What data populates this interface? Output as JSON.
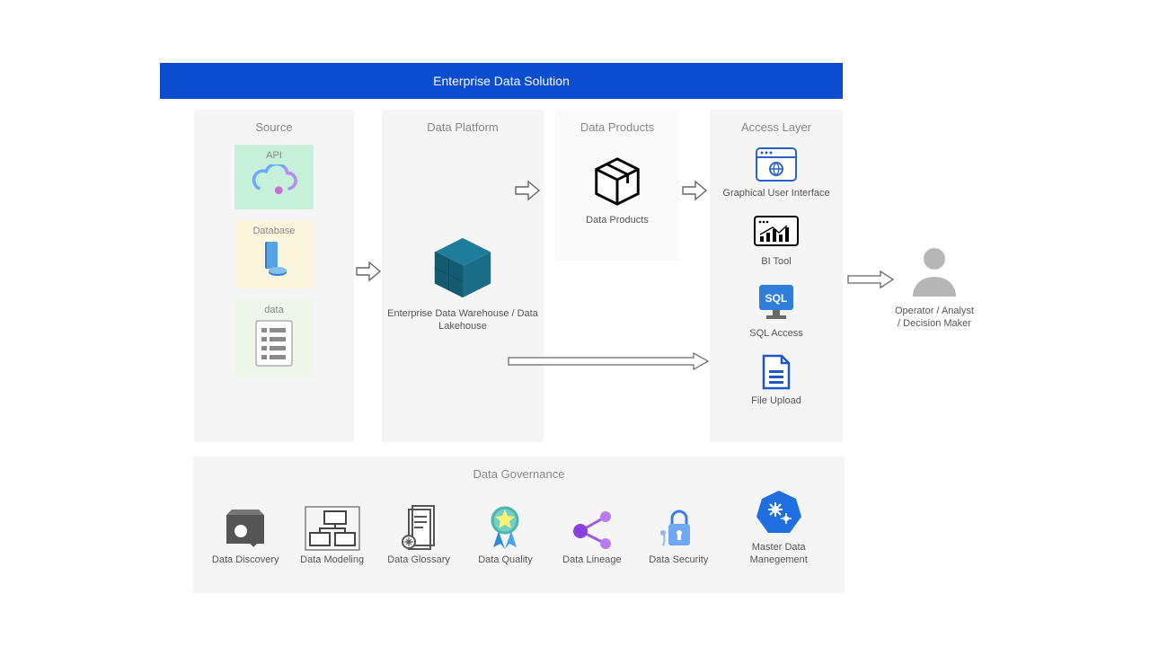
{
  "title": "Enterprise Data Solution",
  "columns": {
    "source": {
      "title": "Source",
      "api": {
        "label": "API"
      },
      "db": {
        "label": "Database"
      },
      "data": {
        "label": "data"
      }
    },
    "platform": {
      "title": "Data Platform",
      "warehouse_label": "Enterprise Data Warehouse / Data Lakehouse"
    },
    "products": {
      "title": "Data Products",
      "label": "Data Products"
    },
    "access": {
      "title": "Access Layer",
      "gui": "Graphical User Interface",
      "bi": "BI Tool",
      "sql": "SQL Access",
      "upload": "File Upload"
    }
  },
  "governance": {
    "title": "Data Governance",
    "items": [
      "Data Discovery",
      "Data Modeling",
      "Data Glossary",
      "Data Quality",
      "Data Lineage",
      "Data Security",
      "Master Data Manegement"
    ]
  },
  "user_label": "Operator / Analyst / Decision Maker",
  "sql_text": "SQL"
}
